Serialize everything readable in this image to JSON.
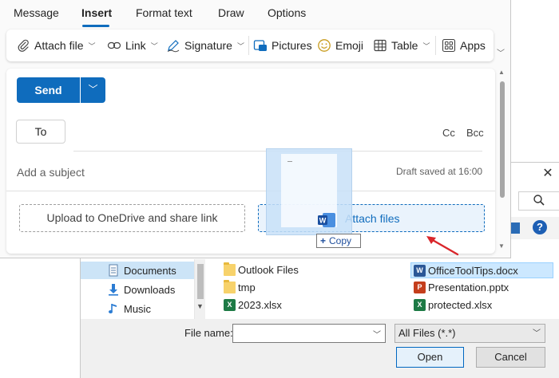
{
  "outlook": {
    "tabs": [
      {
        "label": "Message"
      },
      {
        "label": "Insert"
      },
      {
        "label": "Format text"
      },
      {
        "label": "Draw"
      },
      {
        "label": "Options"
      }
    ],
    "active_tab": "Insert",
    "ribbon": {
      "attach_file": "Attach file",
      "link": "Link",
      "signature": "Signature",
      "pictures": "Pictures",
      "emoji": "Emoji",
      "table": "Table",
      "apps": "Apps"
    },
    "compose": {
      "send_label": "Send",
      "to_label": "To",
      "cc_label": "Cc",
      "bcc_label": "Bcc",
      "subject_placeholder": "Add a subject",
      "draft_status": "Draft saved at 16:00",
      "upload_label": "Upload to OneDrive and share link",
      "attach_label": "Attach files"
    },
    "drag": {
      "copy_label": "Copy"
    },
    "colors": {
      "accent": "#0f6cbd",
      "arrow": "#d9262b"
    }
  },
  "dialog": {
    "nav": [
      {
        "label": "Documents",
        "icon": "documents-icon",
        "selected": true
      },
      {
        "label": "Downloads",
        "icon": "download-icon",
        "selected": false
      },
      {
        "label": "Music",
        "icon": "music-icon",
        "selected": false
      }
    ],
    "files_col1": [
      {
        "name": "Outlook Files",
        "type": "folder"
      },
      {
        "name": "tmp",
        "type": "folder"
      },
      {
        "name": "2023.xlsx",
        "type": "excel"
      }
    ],
    "files_col2": [
      {
        "name": "OfficeToolTips.docx",
        "type": "word",
        "selected": true
      },
      {
        "name": "Presentation.pptx",
        "type": "powerpoint"
      },
      {
        "name": "protected.xlsx",
        "type": "excel"
      }
    ],
    "file_name_label": "File name:",
    "file_name_value": "",
    "file_type": "All Files (*.*)",
    "open_label": "Open",
    "cancel_label": "Cancel"
  }
}
